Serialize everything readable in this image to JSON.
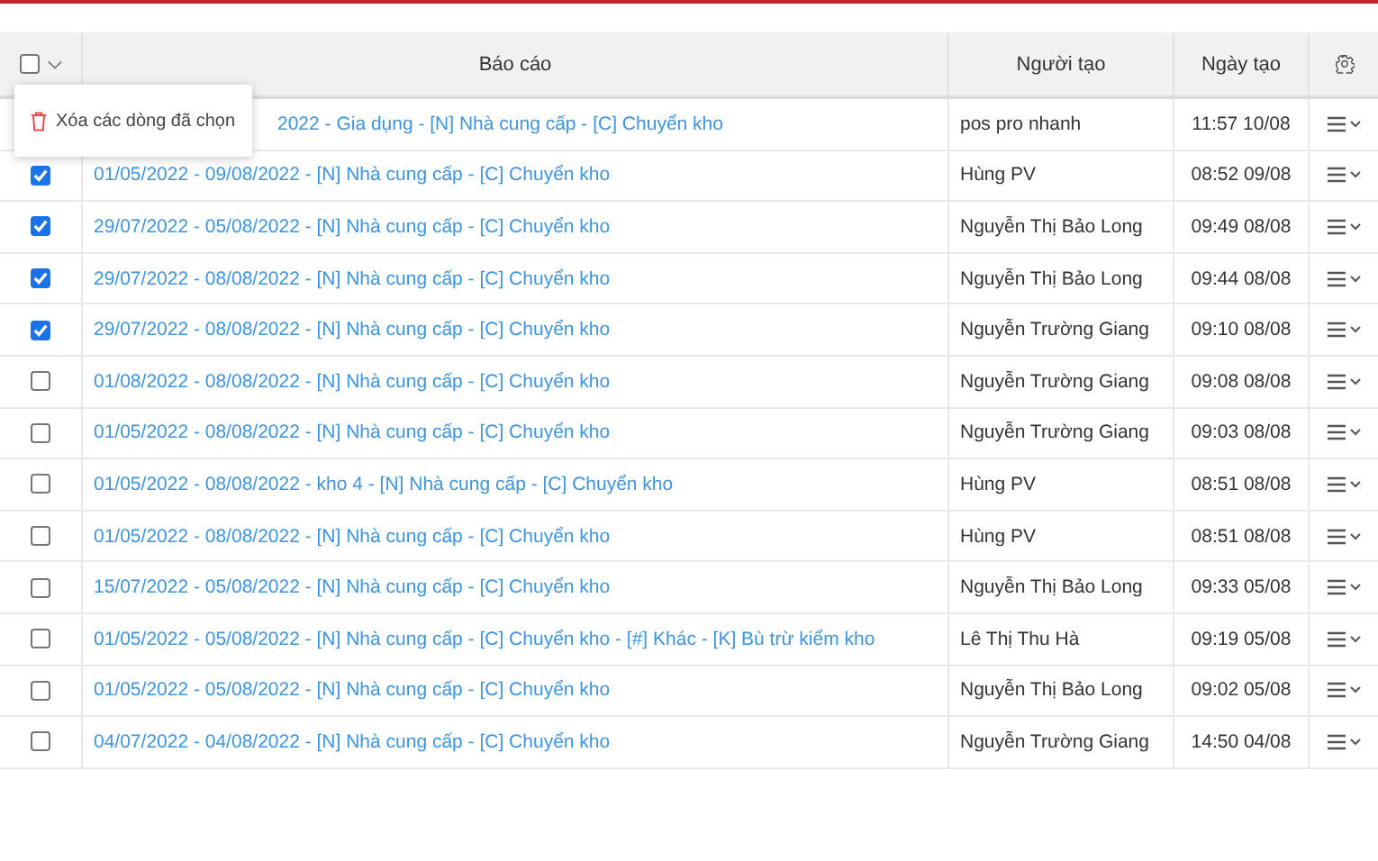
{
  "table": {
    "select_all": {
      "checked": false
    },
    "columns": [
      "Báo cáo",
      "Người tạo",
      "Ngày tạo"
    ],
    "rows": [
      {
        "report": "2022 - Gia dụng - [N] Nhà cung cấp - [C] Chuyển kho",
        "creator": "pos pro nhanh",
        "date": "11:57 10/08"
      },
      {
        "checked": true,
        "report": "01/05/2022 - 09/08/2022 - [N] Nhà cung cấp - [C] Chuyển kho",
        "creator": "Hùng PV",
        "date": "08:52 09/08"
      },
      {
        "checked": true,
        "report": "29/07/2022 - 05/08/2022 - [N] Nhà cung cấp - [C] Chuyển kho",
        "creator": "Nguyễn Thị Bảo Long",
        "date": "09:49 08/08"
      },
      {
        "checked": true,
        "report": "29/07/2022 - 08/08/2022 - [N] Nhà cung cấp - [C] Chuyển kho",
        "creator": "Nguyễn Thị Bảo Long",
        "date": "09:44 08/08"
      },
      {
        "checked": true,
        "report": "29/07/2022 - 08/08/2022 - [N] Nhà cung cấp - [C] Chuyển kho",
        "creator": "Nguyễn Trường Giang",
        "date": "09:10 08/08"
      },
      {
        "checked": false,
        "report": "01/08/2022 - 08/08/2022 - [N] Nhà cung cấp - [C] Chuyển kho",
        "creator": "Nguyễn Trường Giang",
        "date": "09:08 08/08"
      },
      {
        "checked": false,
        "report": "01/05/2022 - 08/08/2022 - [N] Nhà cung cấp - [C] Chuyển kho",
        "creator": "Nguyễn Trường Giang",
        "date": "09:03 08/08"
      },
      {
        "checked": false,
        "report": "01/05/2022 - 08/08/2022 - kho 4 - [N] Nhà cung cấp - [C] Chuyển kho",
        "creator": "Hùng PV",
        "date": "08:51 08/08"
      },
      {
        "checked": false,
        "report": "01/05/2022 - 08/08/2022 - [N] Nhà cung cấp - [C] Chuyển kho",
        "creator": "Hùng PV",
        "date": "08:51 08/08"
      },
      {
        "checked": false,
        "report": "15/07/2022 - 05/08/2022 - [N] Nhà cung cấp - [C] Chuyển kho",
        "creator": "Nguyễn Thị Bảo Long",
        "date": "09:33 05/08"
      },
      {
        "checked": false,
        "report": "01/05/2022 - 05/08/2022 - [N] Nhà cung cấp - [C] Chuyển kho - [#] Khác - [K] Bù trừ kiểm kho",
        "creator": "Lê Thị Thu Hà",
        "date": "09:19 05/08"
      },
      {
        "checked": false,
        "report": "01/05/2022 - 05/08/2022 - [N] Nhà cung cấp - [C] Chuyển kho",
        "creator": "Nguyễn Thị Bảo Long",
        "date": "09:02 05/08"
      },
      {
        "checked": false,
        "report": "04/07/2022 - 04/08/2022 - [N] Nhà cung cấp - [C] Chuyển kho",
        "creator": "Nguyễn Trường Giang",
        "date": "14:50 04/08"
      }
    ]
  },
  "bulk_menu": {
    "items": [
      {
        "label": "Xóa các dòng đã chọn"
      }
    ]
  }
}
